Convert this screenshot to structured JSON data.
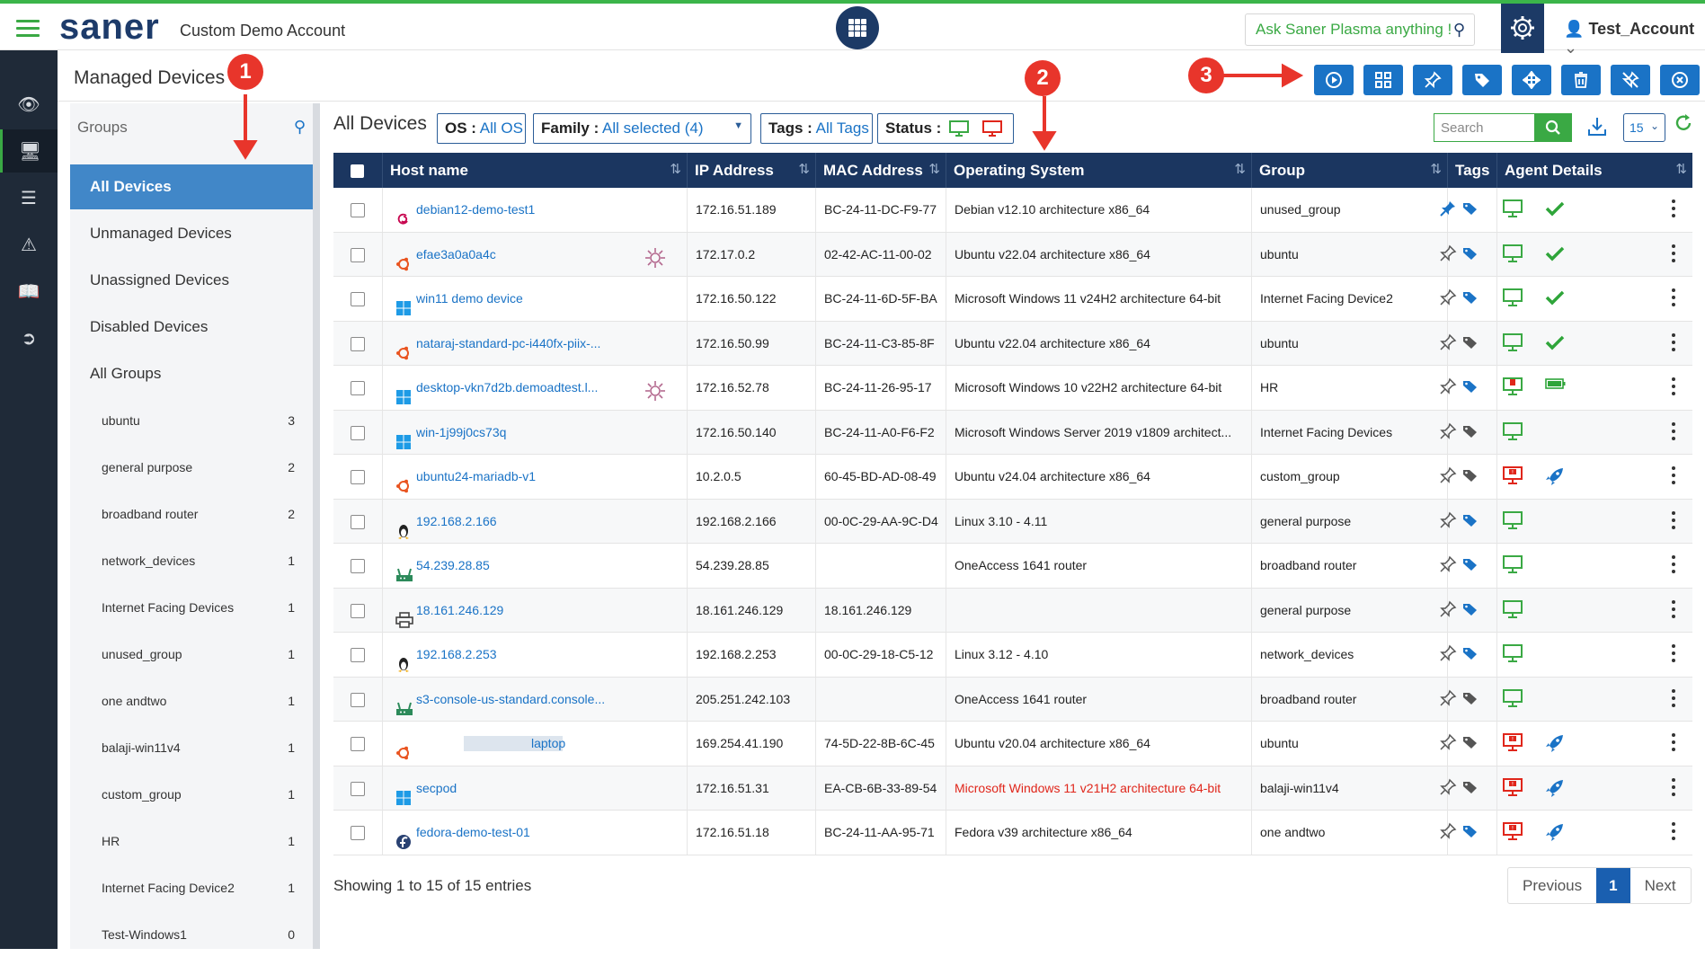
{
  "header": {
    "logo": "saner",
    "account_name": "Custom Demo Account",
    "ask_placeholder": "Ask Saner Plasma anything !",
    "user": "Test_Account"
  },
  "page": {
    "title": "Managed Devices",
    "toolbar_icons": [
      "play-icon",
      "grid-icon",
      "pin-icon",
      "tag-icon",
      "move-icon",
      "trash-icon",
      "unpin-icon",
      "close-circle-icon"
    ]
  },
  "groups": {
    "label": "Groups",
    "items": [
      "All Devices",
      "Unmanaged Devices",
      "Unassigned Devices",
      "Disabled Devices",
      "All Groups"
    ],
    "subgroups": [
      {
        "name": "ubuntu",
        "count": "3"
      },
      {
        "name": "general purpose",
        "count": "2"
      },
      {
        "name": "broadband router",
        "count": "2"
      },
      {
        "name": "network_devices",
        "count": "1"
      },
      {
        "name": "Internet Facing Devices",
        "count": "1"
      },
      {
        "name": "unused_group",
        "count": "1"
      },
      {
        "name": "one andtwo",
        "count": "1"
      },
      {
        "name": "balaji-win11v4",
        "count": "1"
      },
      {
        "name": "custom_group",
        "count": "1"
      },
      {
        "name": "HR",
        "count": "1"
      },
      {
        "name": "Internet Facing Device2",
        "count": "1"
      },
      {
        "name": "Test-Windows1",
        "count": "0"
      }
    ]
  },
  "filters": {
    "title": "All Devices",
    "os_label": "OS :",
    "os_value": "All OS",
    "family_label": "Family :",
    "family_value": "All selected (4)",
    "tags_label": "Tags :",
    "tags_value": "All Tags",
    "status_label": "Status :",
    "search_placeholder": "Search",
    "per_page": "15"
  },
  "table": {
    "columns": [
      "Host name",
      "IP Address",
      "MAC Address",
      "Operating System",
      "Group",
      "Tags",
      "Agent Details"
    ],
    "rows": [
      {
        "host": "debian12-demo-test1",
        "ip": "172.16.51.189",
        "mac": "BC-24-11-DC-F9-77",
        "os": "Debian v12.10 architecture x86_64",
        "group": "unused_group",
        "os_icon": "debian-icon",
        "pinned": true,
        "tag_color": "#1a73c6",
        "monitor": "green",
        "status": "check",
        "vuln": false
      },
      {
        "host": "efae3a0a0a4c",
        "ip": "172.17.0.2",
        "mac": "02-42-AC-11-00-02",
        "os": "Ubuntu v22.04 architecture x86_64",
        "group": "ubuntu",
        "os_icon": "ubuntu-icon",
        "pinned": false,
        "tag_color": "#1a73c6",
        "monitor": "green",
        "status": "check",
        "vuln": true
      },
      {
        "host": "win11 demo device",
        "ip": "172.16.50.122",
        "mac": "BC-24-11-6D-5F-BA",
        "os": "Microsoft Windows 11 v24H2 architecture 64-bit",
        "group": "Internet Facing Device2",
        "os_icon": "windows-icon",
        "pinned": false,
        "tag_color": "#1a73c6",
        "monitor": "green",
        "status": "check",
        "vuln": false
      },
      {
        "host": "nataraj-standard-pc-i440fx-piix-...",
        "ip": "172.16.50.99",
        "mac": "BC-24-11-C3-85-8F",
        "os": "Ubuntu v22.04 architecture x86_64",
        "group": "ubuntu",
        "os_icon": "ubuntu-icon",
        "pinned": false,
        "tag_color": "#555555",
        "monitor": "green",
        "status": "check",
        "vuln": false
      },
      {
        "host": "desktop-vkn7d2b.demoadtest.l...",
        "ip": "172.16.52.78",
        "mac": "BC-24-11-26-95-17",
        "os": "Microsoft Windows 10 v22H2 architecture 64-bit",
        "group": "HR",
        "os_icon": "windows-icon",
        "pinned": false,
        "tag_color": "#1a73c6",
        "monitor": "green-alert",
        "status": "battery",
        "vuln": true
      },
      {
        "host": "win-1j99j0cs73q",
        "ip": "172.16.50.140",
        "mac": "BC-24-11-A0-F6-F2",
        "os": "Microsoft Windows Server 2019 v1809 architect...",
        "group": "Internet Facing Devices",
        "os_icon": "windows-icon",
        "pinned": false,
        "tag_color": "#555555",
        "monitor": "green",
        "status": "none",
        "vuln": false
      },
      {
        "host": "ubuntu24-mariadb-v1",
        "ip": "10.2.0.5",
        "mac": "60-45-BD-AD-08-49",
        "os": "Ubuntu v24.04 architecture x86_64",
        "group": "custom_group",
        "os_icon": "ubuntu-icon",
        "pinned": false,
        "tag_color": "#555555",
        "monitor": "red",
        "status": "rocket",
        "vuln": false
      },
      {
        "host": "192.168.2.166",
        "ip": "192.168.2.166",
        "mac": "00-0C-29-AA-9C-D4",
        "os": "Linux 3.10 - 4.11",
        "group": "general purpose",
        "os_icon": "linux-icon",
        "pinned": false,
        "tag_color": "#1a73c6",
        "monitor": "green",
        "status": "none",
        "vuln": false
      },
      {
        "host": "54.239.28.85",
        "ip": "54.239.28.85",
        "mac": "",
        "os": "OneAccess 1641 router",
        "group": "broadband router",
        "os_icon": "router-icon",
        "pinned": false,
        "tag_color": "#1a73c6",
        "monitor": "green",
        "status": "none",
        "vuln": false
      },
      {
        "host": "18.161.246.129",
        "ip": "18.161.246.129",
        "mac": "18.161.246.129",
        "os": "",
        "group": "general purpose",
        "os_icon": "printer-icon",
        "pinned": false,
        "tag_color": "#1a73c6",
        "monitor": "green",
        "status": "none",
        "vuln": false
      },
      {
        "host": "192.168.2.253",
        "ip": "192.168.2.253",
        "mac": "00-0C-29-18-C5-12",
        "os": "Linux 3.12 - 4.10",
        "group": "network_devices",
        "os_icon": "linux-icon",
        "pinned": false,
        "tag_color": "#1a73c6",
        "monitor": "green",
        "status": "none",
        "vuln": false
      },
      {
        "host": "s3-console-us-standard.console...",
        "ip": "205.251.242.103",
        "mac": "",
        "os": "OneAccess 1641 router",
        "group": "broadband router",
        "os_icon": "router-icon",
        "pinned": false,
        "tag_color": "#555555",
        "monitor": "green",
        "status": "none",
        "vuln": false
      },
      {
        "host": "laptop",
        "ip": "169.254.41.190",
        "mac": "74-5D-22-8B-6C-45",
        "os": "Ubuntu v20.04 architecture x86_64",
        "group": "ubuntu",
        "os_icon": "ubuntu-icon",
        "pinned": false,
        "tag_color": "#555555",
        "monitor": "red",
        "status": "rocket",
        "vuln": false,
        "masked": true
      },
      {
        "host": "secpod",
        "ip": "172.16.51.31",
        "mac": "EA-CB-6B-33-89-54",
        "os": "Microsoft Windows 11 v21H2 architecture 64-bit",
        "group": "balaji-win11v4",
        "os_icon": "windows-icon",
        "pinned": false,
        "tag_color": "#555555",
        "monitor": "red",
        "status": "rocket",
        "vuln": false,
        "os_red": true
      },
      {
        "host": "fedora-demo-test-01",
        "ip": "172.16.51.18",
        "mac": "BC-24-11-AA-95-71",
        "os": "Fedora v39 architecture x86_64",
        "group": "one andtwo",
        "os_icon": "fedora-icon",
        "pinned": false,
        "tag_color": "#1a73c6",
        "monitor": "red",
        "status": "rocket",
        "vuln": false
      }
    ]
  },
  "footer": {
    "showing": "Showing 1 to 15 of 15 entries",
    "prev": "Previous",
    "page": "1",
    "next": "Next"
  },
  "annotations": [
    "1",
    "2",
    "3"
  ],
  "colors": {
    "navy": "#1b3660",
    "accent_blue": "#1a73c6",
    "brand_green": "#3aa944",
    "annotation_red": "#e8352b"
  }
}
